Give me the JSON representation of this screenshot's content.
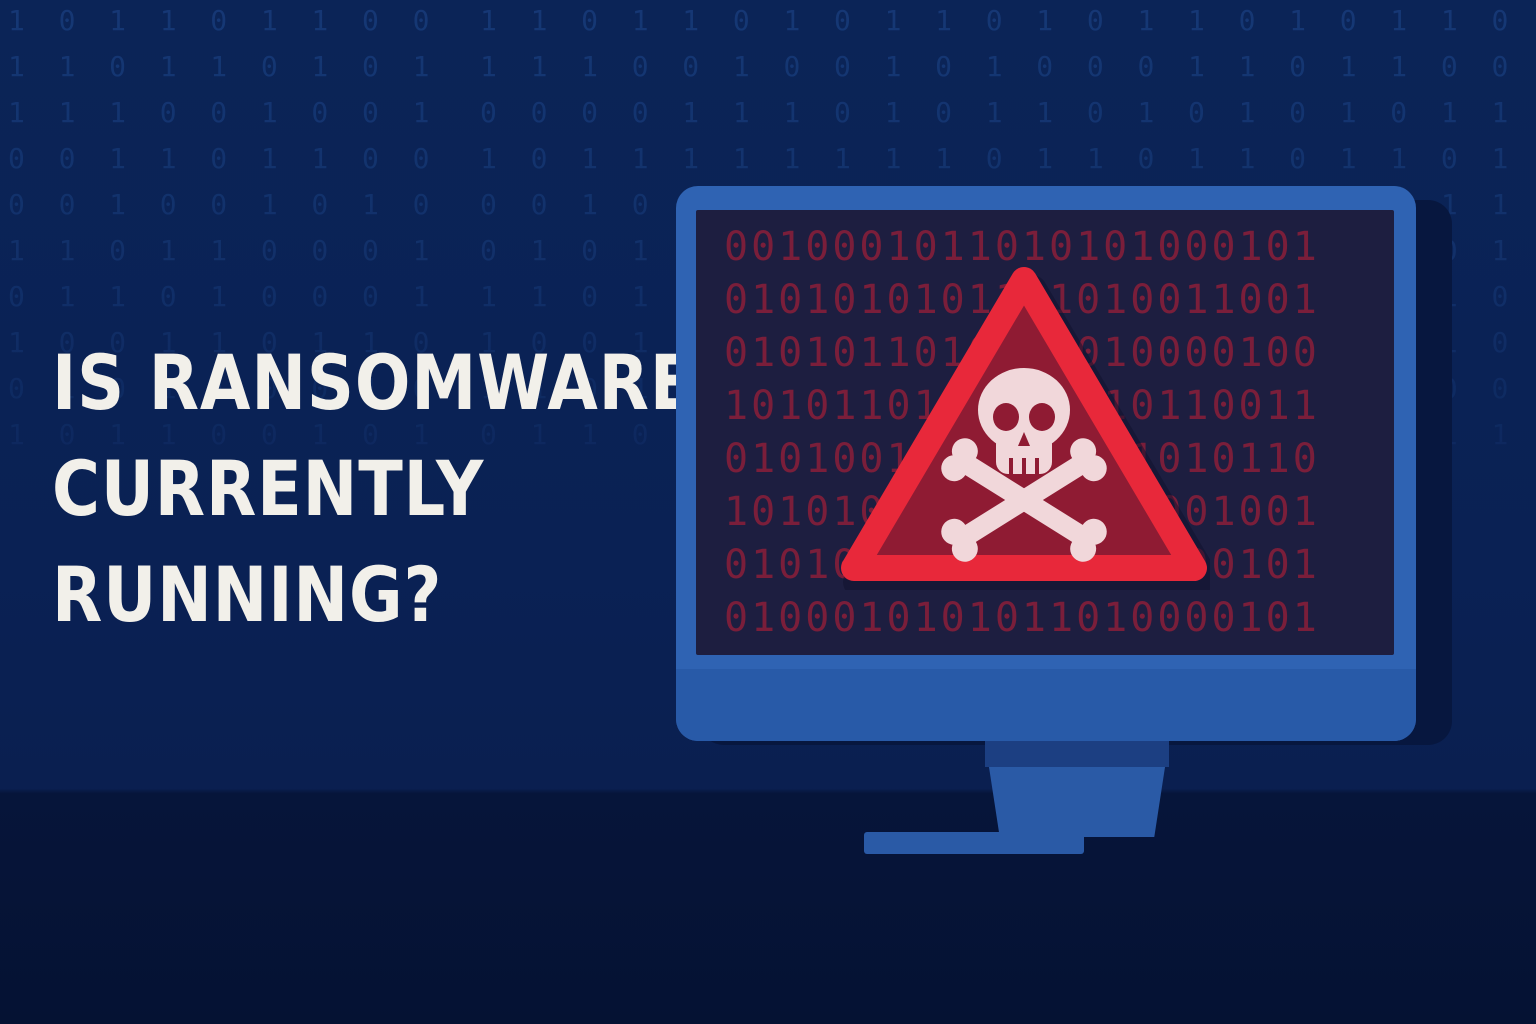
{
  "headline": {
    "line1": "IS RANSOMWARE",
    "line2": "CURRENTLY",
    "line3": "RUNNING?"
  },
  "background_code": {
    "rows": [
      "1  0  1  1  0  1  1  0  0   1  1  0  1  1  0  1  0  1  1  0  1  0  1  1  0  1  0  1  1  0  1  1",
      "1  1  0  1  1  0  1  0  1   1  1  1  0  0  1  0  0  1  0  1  0  0  0  1  1  0  1  1  0  0  1  0",
      "1  1  1  0  0  1  0  0  1   0  0  0  0  1  1  1  0  1  0  1  1  0  1  0  1  0  1  0  1  1  0  1",
      "0  0  1  1  0  1  1  0  0   1  0  1  1  1  1  1  1  1  1  0  1  1  0  1  1  0  1  1  0  1  1  1",
      "0  0  1  0  0  1  0  1  0   0  0  1  0  1  0  1  0  1  1  0  0  1  0  1  0  1  0  0  1  1  0  1",
      "1  1  0  1  1  0  0  0  1   0  1  0  1  0  1  1  0  0  1  0  0  0  1  1  0  1  1  0  0  1  0  1",
      "0  1  1  0  1  0  0  0  1   1  1  0  1  0  1  1  1  0  1  0  1  0  0  1  0  1  1  0  1  0  1  1",
      "1  0  0  1  1  0  1  1  0   1  0  0  1  1  0  1  0  1  0  0  1  1  0  1  0  1  0  1  1  0  0  1",
      "0  1  0  1  1  0  0  1  0   1  1  0  1  0  0  1  0  1  0  1  1  0  1  0  1  1  0  1  0  0  1  0",
      "1  0  1  1  0  0  1  0  1   0  1  1  0  0  1  0  1  1  0  1  0  0  1  1  0  0  1  0  1  1  0  1"
    ]
  },
  "screen_code": {
    "rows": [
      "0010001011010101000101",
      "0101010101101010011001",
      "0101011010101010000100",
      "1010110101001010110011",
      "0101001010100101010110",
      "1010101010101001001001",
      "0101010101010101000101",
      "0100010101011010000101"
    ]
  },
  "warning_icon": {
    "symbol": "skull-and-crossbones",
    "triangle_color": "#e8283a",
    "triangle_fill": "#8f1b33",
    "skull_color": "#f1d7da"
  }
}
